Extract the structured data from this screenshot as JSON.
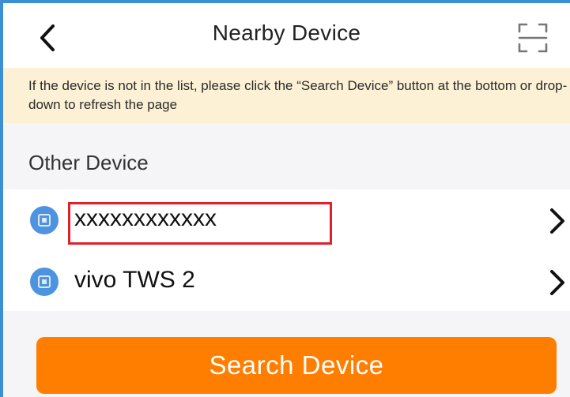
{
  "header": {
    "title": "Nearby Device",
    "back_icon": "chevron-left-icon",
    "scan_icon": "scan-frame-icon"
  },
  "notice": {
    "text": "If the device is not in the list, please click the “Search Device” button at the bottom or drop-down to refresh the page"
  },
  "section": {
    "label": "Other Device"
  },
  "devices": [
    {
      "name": "xxxxxxxxxxxx",
      "icon": "device-icon",
      "highlighted": true
    },
    {
      "name": "vivo TWS 2",
      "icon": "device-icon",
      "highlighted": false
    }
  ],
  "actions": {
    "search_label": "Search Device"
  },
  "colors": {
    "accent": "#ff7e00",
    "notice_bg": "#fcf1d5",
    "device_icon": "#4d93e0",
    "highlight": "#e0202b",
    "frame_border": "#3a8fd6"
  }
}
